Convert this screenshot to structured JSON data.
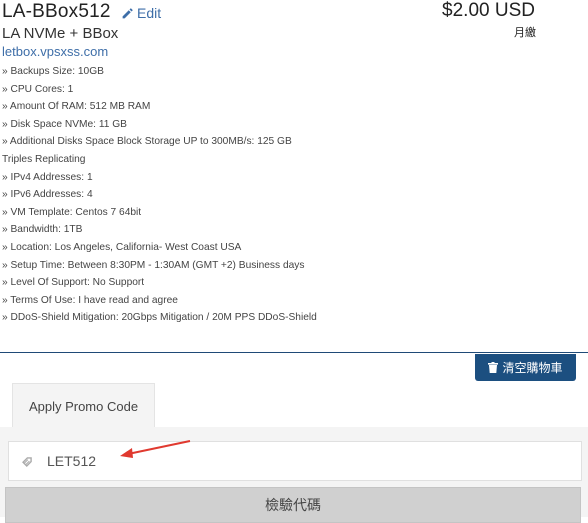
{
  "product": {
    "name": "LA-BBox512",
    "edit_label": "Edit",
    "price": "$2.00 USD",
    "billing_cycle": "月繳",
    "subtitle": "LA NVMe + BBox",
    "domain": "letbox.vpsxss.com",
    "features": [
      "» Backups Size: 10GB",
      "» CPU Cores: 1",
      "» Amount Of RAM: 512 MB RAM",
      "» Disk Space NVMe: 11 GB",
      "» Additional Disks Space Block Storage UP to 300MB/s: 125 GB Triples Replicating",
      "» IPv4 Addresses: 1",
      "» IPv6 Addresses: 4",
      "» VM Template: Centos 7 64bit",
      "» Bandwidth: 1TB",
      "» Location: Los Angeles, California- West Coast USA",
      "» Setup Time: Between 8:30PM - 1:30AM (GMT +2) Business days",
      "» Level Of Support: No Support",
      "» Terms Of Use: I have read and agree",
      "» DDoS-Shield Mitigation: 20Gbps Mitigation / 20M PPS DDoS-Shield"
    ]
  },
  "cart": {
    "clear_label": "清空購物車"
  },
  "promo": {
    "tab_label": "Apply Promo Code",
    "code_value": "LET512",
    "validate_label": "檢驗代碼"
  },
  "colors": {
    "accent": "#1c4f80",
    "link": "#3e6ea8",
    "arrow": "#e0392f"
  },
  "icons": [
    "pencil-icon",
    "trash-icon",
    "tag-icon",
    "arrow-annotation"
  ]
}
